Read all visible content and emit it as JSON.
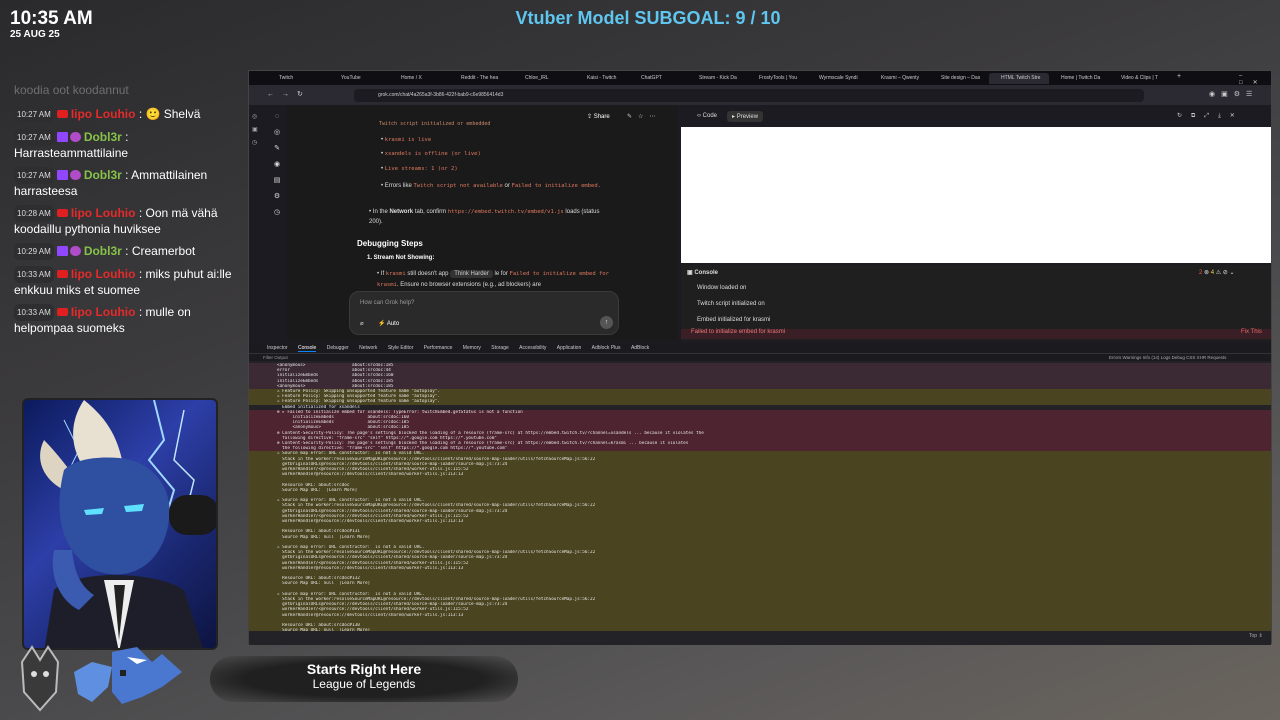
{
  "clock": {
    "time": "10:35 AM",
    "date": "25 AUG 25"
  },
  "subgoal": "Vtuber Model SUBGOAL: 9 / 10",
  "chat": {
    "faded_top": "koodia oot koodannut",
    "messages": [
      {
        "time": "10:27 AM",
        "platform": "youtube",
        "user": "Iipo Louhio",
        "color": "red",
        "text": ": 🙂 Shelvä"
      },
      {
        "time": "10:27 AM",
        "platform": "twitch",
        "user": "Dobl3r",
        "color": "green",
        "text": ": Harrasteammattilaine"
      },
      {
        "time": "10:27 AM",
        "platform": "twitch",
        "user": "Dobl3r",
        "color": "green",
        "text": ": Ammattilainen harrasteesa"
      },
      {
        "time": "10:28 AM",
        "platform": "youtube",
        "user": "Iipo Louhio",
        "color": "red",
        "text": ": Oon mä vähä koodaillu pythonia huviksee"
      },
      {
        "time": "10:29 AM",
        "platform": "twitch",
        "user": "Dobl3r",
        "color": "green",
        "text": ": Creamerbot"
      },
      {
        "time": "10:33 AM",
        "platform": "youtube",
        "user": "Iipo Louhio",
        "color": "red",
        "text": ": miks puhut ai:lle enkkuu miks et suomee"
      },
      {
        "time": "10:33 AM",
        "platform": "youtube",
        "user": "Iipo Louhio",
        "color": "red",
        "text": ": mulle on helpompaa suomeks"
      }
    ]
  },
  "browser": {
    "tabs": [
      "Twitch",
      "YouTube",
      "Home / X",
      "Reddit - The hea",
      "Chloe_IRL",
      "Kaisi - Twitch",
      "ChatGPT",
      "Stream - Kick Da",
      "FrostyTools | You",
      "Wyrmscale Syndi",
      "Krasmi – Qwenty",
      "Site design – Das",
      "HTML Twitch Stre",
      "Home | Twitch Da",
      "Video & Clips | T"
    ],
    "url": "grok.com/chat/4a265a3f-3b86-422f-bab9-c6e9856414d3",
    "content": {
      "l1": "Twitch script initialized or embedded",
      "b1": "krasmi is live",
      "b2": "xsandels is offline (or live)",
      "b3": "Live streams: 1 (or 2)",
      "b4a": "Errors like",
      "b4b": "Twitch script not available",
      "b4c": "or",
      "b4d": "Failed to initialize embed.",
      "net1": "In the",
      "net2": "Network",
      "net3": "tab, confirm",
      "net4": "https://embed.twitch.tv/embed/v1.js",
      "net5": "loads (status 200).",
      "heading": "Debugging Steps",
      "step": "1. Stream Not Showing:",
      "stepsub1": "If",
      "stepsub2": "krasmi",
      "stepsub3": "still doesn't app",
      "think": "Think Harder",
      "stepsub4": "le for",
      "stepsub5": "Failed to initialize embed for krasmi",
      "stepsub6": ". Ensure no browser extensions (e.g., ad blockers) are",
      "share": "Share",
      "ask_placeholder": "How can Grok help?",
      "mode": "Auto"
    },
    "preview": {
      "code": "Code",
      "preview": "Preview"
    },
    "console": {
      "title": "Console",
      "lines": [
        "Window loaded on",
        "Twitch script initialized on",
        "Embed initialized for krasmi"
      ],
      "error": "Failed to initialize embed for krasmi",
      "fix": "Fix This",
      "err_count": "2",
      "warn_count": "4"
    },
    "devtools": {
      "tabs": [
        "Inspector",
        "Console",
        "Debugger",
        "Network",
        "Style Editor",
        "Performance",
        "Memory",
        "Storage",
        "Accessibility",
        "Application",
        "Adblock Plus",
        "AdBlock"
      ],
      "filter": "Filter Output",
      "right_filters": "Errors  Warnings  Info (14)  Logs  Debug   CSS  XHR  Requests",
      "logs": [
        {
          "k": "b",
          "t": "<anonymous>                  about:srcdoc:185"
        },
        {
          "k": "b",
          "t": "error                        about:srcdoc:44"
        },
        {
          "k": "b",
          "t": "initializeEmbeds             about:srcdoc:160"
        },
        {
          "k": "b",
          "t": "initializeEmbeds             about:srcdoc:185"
        },
        {
          "k": "b",
          "t": "<anonymous>                  about:srcdoc:185"
        },
        {
          "k": "w",
          "t": "⚠ Feature Policy: Skipping unsupported feature name \"autoplay\"."
        },
        {
          "k": "w",
          "t": "⚠ Feature Policy: Skipping unsupported feature name \"autoplay\"."
        },
        {
          "k": "w",
          "t": "⚠ Feature Policy: Skipping unsupported feature name \"autoplay\"."
        },
        {
          "k": "n",
          "t": "  Embed initialized for xsandels"
        },
        {
          "k": "e",
          "t": "⊗ ▸ Failed to initialize embed for xsandels: TypeError: twitchEmbed.getStatus is not a function"
        },
        {
          "k": "e",
          "t": "      initializeEmbeds             about:srcdoc:160"
        },
        {
          "k": "e",
          "t": "      initializeEmbeds             about:srcdoc:185"
        },
        {
          "k": "e",
          "t": "      <anonymous>                  about:srcdoc:185"
        },
        {
          "k": "e",
          "t": "⊗ Content-Security-Policy: The page's settings blocked the loading of a resource (frame-src) at https://embed.twitch.tv/?channel=xsandels ... because it violates the"
        },
        {
          "k": "e",
          "t": "  following directive: \"frame-src\" \"self\" https://*.google.com https://*.youtube.com\""
        },
        {
          "k": "e",
          "t": "⊗ Content-Security-Policy: The page's settings blocked the loading of a resource (frame-src) at https://embed.twitch.tv/?channel=krasmi ... because it violates"
        },
        {
          "k": "e",
          "t": "  the following directive: \"frame-src\" \"self\" https://*.google.com https://*.youtube.com\""
        },
        {
          "k": "w",
          "t": "⚠ Source map error: URL constructor:  is not a valid URL."
        },
        {
          "k": "w",
          "t": "  Stack in the worker:resolveSourceMapURL@resource://devtools/client/shared/source-map-loader/utils/fetchSourceMap.js:56:22"
        },
        {
          "k": "w",
          "t": "  getOriginalURLs@resource://devtools/client/shared/source-map-loader/source-map.js:73:24"
        },
        {
          "k": "w",
          "t": "  workerHandler/<@resource://devtools/client/shared/worker-utils.js:115:52"
        },
        {
          "k": "w",
          "t": "  workerHandler@resource://devtools/client/shared/worker-utils.js:113:13"
        },
        {
          "k": "w",
          "t": " "
        },
        {
          "k": "w",
          "t": "  Resource URL: about:srcdoc"
        },
        {
          "k": "w",
          "t": "  Source Map URL:  [Learn More]"
        },
        {
          "k": "w",
          "t": " "
        },
        {
          "k": "w",
          "t": "⚠ Source map error: URL constructor:  is not a valid URL."
        },
        {
          "k": "w",
          "t": "  Stack in the worker:resolveSourceMapURL@resource://devtools/client/shared/source-map-loader/utils/fetchSourceMap.js:56:22"
        },
        {
          "k": "w",
          "t": "  getOriginalURLs@resource://devtools/client/shared/source-map-loader/source-map.js:73:24"
        },
        {
          "k": "w",
          "t": "  workerHandler/<@resource://devtools/client/shared/worker-utils.js:115:52"
        },
        {
          "k": "w",
          "t": "  workerHandler@resource://devtools/client/shared/worker-utils.js:113:13"
        },
        {
          "k": "w",
          "t": " "
        },
        {
          "k": "w",
          "t": "  Resource URL: about:srcdoc#131"
        },
        {
          "k": "w",
          "t": "  Source Map URL: null  [Learn More]"
        },
        {
          "k": "w",
          "t": " "
        },
        {
          "k": "w",
          "t": "⚠ Source map error: URL constructor:  is not a valid URL."
        },
        {
          "k": "w",
          "t": "  Stack in the worker:resolveSourceMapURL@resource://devtools/client/shared/source-map-loader/utils/fetchSourceMap.js:56:22"
        },
        {
          "k": "w",
          "t": "  getOriginalURLs@resource://devtools/client/shared/source-map-loader/source-map.js:73:24"
        },
        {
          "k": "w",
          "t": "  workerHandler/<@resource://devtools/client/shared/worker-utils.js:115:52"
        },
        {
          "k": "w",
          "t": "  workerHandler@resource://devtools/client/shared/worker-utils.js:113:13"
        },
        {
          "k": "w",
          "t": " "
        },
        {
          "k": "w",
          "t": "  Resource URL: about:srcdoc#132"
        },
        {
          "k": "w",
          "t": "  Source Map URL: null  [Learn More]"
        },
        {
          "k": "w",
          "t": " "
        },
        {
          "k": "w",
          "t": "⚠ Source map error: URL constructor:  is not a valid URL."
        },
        {
          "k": "w",
          "t": "  Stack in the worker:resolveSourceMapURL@resource://devtools/client/shared/source-map-loader/utils/fetchSourceMap.js:56:22"
        },
        {
          "k": "w",
          "t": "  getOriginalURLs@resource://devtools/client/shared/source-map-loader/source-map.js:73:24"
        },
        {
          "k": "w",
          "t": "  workerHandler/<@resource://devtools/client/shared/worker-utils.js:115:52"
        },
        {
          "k": "w",
          "t": "  workerHandler@resource://devtools/client/shared/worker-utils.js:113:13"
        },
        {
          "k": "w",
          "t": " "
        },
        {
          "k": "w",
          "t": "  Resource URL: about:srcdoc#130"
        },
        {
          "k": "w",
          "t": "  Source Map URL: null  [Learn More]"
        }
      ],
      "top": "Top ⇕"
    }
  },
  "starts": {
    "title": "Starts Right Here",
    "subtitle": "League of Legends"
  },
  "colors": {
    "subgoal": "#5fc6f0",
    "youtube_name": "#e52a2a",
    "twitch_name": "#86c24a",
    "console_error": "#4e2430",
    "console_warn": "#4a4420"
  }
}
